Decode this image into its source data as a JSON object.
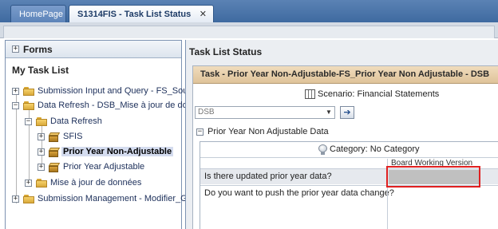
{
  "tabs": [
    {
      "label": "HomePage",
      "active": false
    },
    {
      "label": "S1314FIS - Task List Status",
      "active": true,
      "close_symbol": "✕"
    }
  ],
  "left_panel": {
    "forms_title": "Forms",
    "my_task_list_title": "My Task List",
    "tree": [
      {
        "label": "Submission Input and Query - FS_Soumi",
        "icon": "folder-icon",
        "expander": "+"
      },
      {
        "label": "Data Refresh - DSB_Mise à jour de donn",
        "icon": "folder-icon",
        "expander": "−"
      },
      {
        "label": "Data Refresh",
        "icon": "folder-icon",
        "expander": "−"
      },
      {
        "label": "SFIS",
        "icon": "cube-icon",
        "expander": "+"
      },
      {
        "label": "Prior Year Non-Adjustable",
        "icon": "cube-icon",
        "expander": "+",
        "selected": true
      },
      {
        "label": "Prior Year Adjustable",
        "icon": "cube-icon",
        "expander": "+"
      },
      {
        "label": "Mise à jour de données",
        "icon": "folder-icon",
        "expander": "+"
      },
      {
        "label": "Submission Management - Modifier_Gest",
        "icon": "folder-icon",
        "expander": "+"
      }
    ]
  },
  "right_panel": {
    "title": "Task List Status",
    "task_header": "Task - Prior Year Non-Adjustable-FS_Prior Year Non Adjustable - DSB",
    "scenario": "Scenario: Financial Statements",
    "pov": {
      "value": "DSB",
      "go_label": "➔"
    },
    "section": {
      "expander": "−",
      "label": "Prior Year Non Adjustable Data"
    },
    "category": "Category: No Category",
    "column_header": "Board Working Version",
    "questions": [
      "Is there updated prior year data?",
      "Do you want to push the prior year data change?"
    ]
  },
  "colors": {
    "top_bar": "#4a74a9",
    "task_header": "#e6cda6",
    "highlight": "#e02020",
    "answer_cell": "#c0c0c0"
  }
}
